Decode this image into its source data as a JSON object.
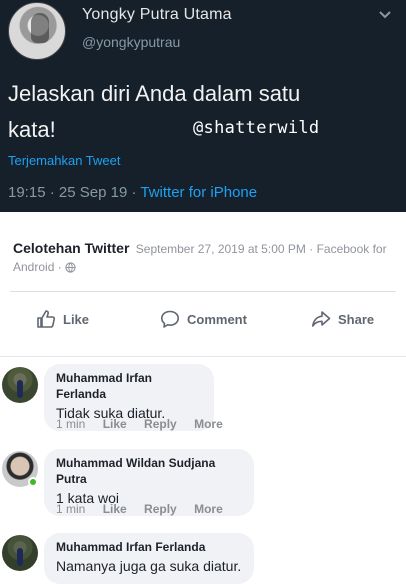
{
  "tweet": {
    "name": "Yongky Putra Utama",
    "handle": "@yongkyputrau",
    "text_line1": "Jelaskan diri Anda dalam satu",
    "text_line2": "kata!",
    "overlay": "@shatterwild",
    "translate": "Terjemahkan Tweet",
    "time": "19:15",
    "date": "25 Sep 19",
    "source": "Twitter for iPhone",
    "separator": "·",
    "bg_color": "#15202b",
    "link_color": "#1da1f2"
  },
  "fb_post": {
    "page_name": "Celotehan Twitter",
    "timestamp": "September 27, 2019 at 5:00 PM",
    "separator": "·",
    "via": "Facebook for Android",
    "actions": {
      "like": "Like",
      "comment": "Comment",
      "share": "Share"
    }
  },
  "comments": [
    {
      "name": "Muhammad Irfan Ferlanda",
      "text": "Tidak suka diatur.",
      "time": "1 min",
      "like": "Like",
      "reply": "Reply",
      "more": "More"
    },
    {
      "name": "Muhammad Wildan Sudjana Putra",
      "text": "1 kata woi",
      "time": "1 min",
      "like": "Like",
      "reply": "Reply",
      "more": "More"
    },
    {
      "name": "Muhammad Irfan Ferlanda",
      "text": "Namanya juga ga suka diatur."
    }
  ]
}
